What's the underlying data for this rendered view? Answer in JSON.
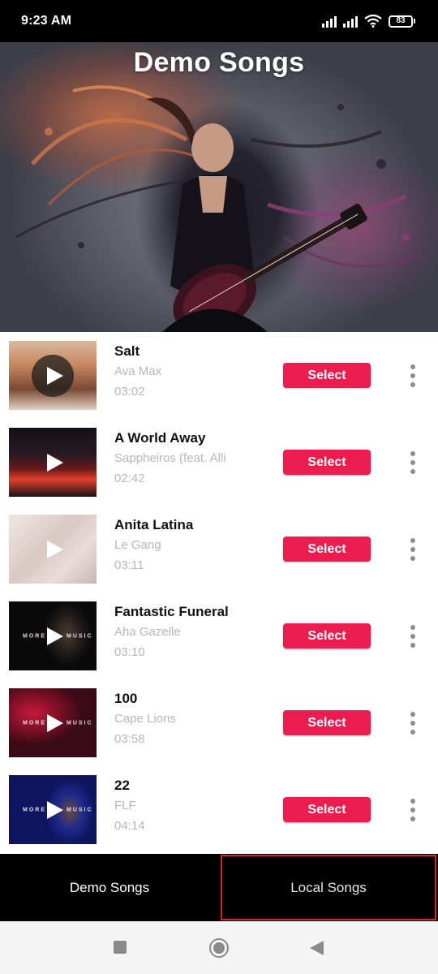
{
  "status_bar": {
    "time": "9:23 AM",
    "battery": "83",
    "icons": [
      "signal-icon",
      "signal-icon",
      "wifi-icon",
      "battery-icon"
    ]
  },
  "header": {
    "title": "Demo Songs"
  },
  "songs": [
    {
      "title": "Salt",
      "artist": "Ava Max",
      "duration": "03:02",
      "action_label": "Select"
    },
    {
      "title": "A World Away",
      "artist": "Sappheiros (feat. Alli",
      "duration": "02:42",
      "action_label": "Select"
    },
    {
      "title": "Anita Latina",
      "artist": "Le Gang",
      "duration": "03:11",
      "action_label": "Select"
    },
    {
      "title": "Fantastic Funeral",
      "artist": "Aha Gazelle",
      "duration": "03:10",
      "action_label": "Select"
    },
    {
      "title": "100",
      "artist": "Cape Lions",
      "duration": "03:58",
      "action_label": "Select"
    },
    {
      "title": "22",
      "artist": "FLF",
      "duration": "04:14",
      "action_label": "Select"
    }
  ],
  "thumb_overlay_words": {
    "more": "MORE",
    "music": "MUSIC"
  },
  "tabs": [
    {
      "label": "Demo Songs",
      "active": true
    },
    {
      "label": "Local Songs",
      "active": false,
      "highlighted": true
    }
  ],
  "colors": {
    "accent": "#ec1c4e",
    "highlight_border": "#d7262b",
    "status_bar_bg": "#000000",
    "tab_bar_bg": "#000000"
  }
}
